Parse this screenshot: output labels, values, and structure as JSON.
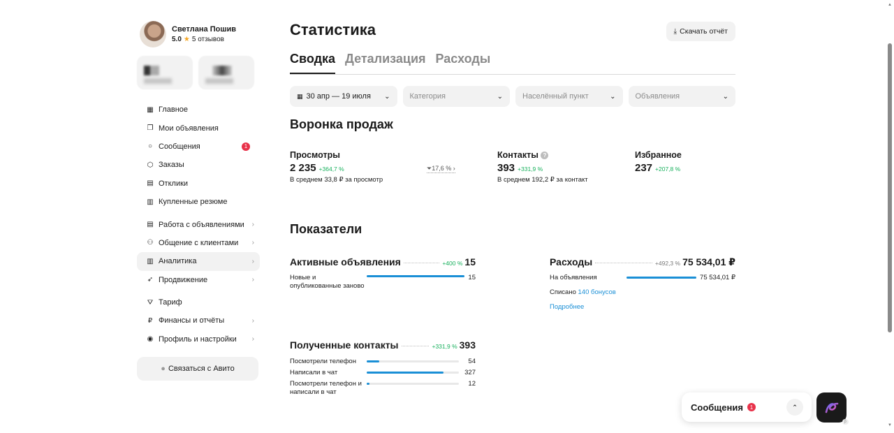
{
  "profile": {
    "name": "Светлана Пошив",
    "rating": "5.0",
    "reviews": "5 отзывов"
  },
  "sidebar": {
    "items": [
      {
        "icon": "grid-icon",
        "glyph": "▦",
        "label": "Главное"
      },
      {
        "icon": "copy-icon",
        "glyph": "❐",
        "label": "Мои объявления"
      },
      {
        "icon": "chat-icon",
        "glyph": "○",
        "label": "Сообщения",
        "badge": "1"
      },
      {
        "icon": "box-icon",
        "glyph": "⬡",
        "label": "Заказы"
      },
      {
        "icon": "doc-icon",
        "glyph": "▤",
        "label": "Отклики"
      },
      {
        "icon": "resume-icon",
        "glyph": "▥",
        "label": "Купленные резюме"
      }
    ],
    "items2": [
      {
        "icon": "list-icon",
        "glyph": "▤",
        "label": "Работа с объявлениями"
      },
      {
        "icon": "users-icon",
        "glyph": "⚇",
        "label": "Общение с клиентами"
      },
      {
        "icon": "analytics-icon",
        "glyph": "▥",
        "label": "Аналитика"
      },
      {
        "icon": "rocket-icon",
        "glyph": "➶",
        "label": "Продвижение"
      }
    ],
    "items3": [
      {
        "icon": "tariff-icon",
        "glyph": "⛛",
        "label": "Тариф"
      },
      {
        "icon": "ruble-icon",
        "glyph": "₽",
        "label": "Финансы и отчёты"
      },
      {
        "icon": "profile-icon",
        "glyph": "◉",
        "label": "Профиль и настройки"
      }
    ],
    "contact_label": "Связаться с Авито"
  },
  "header": {
    "title": "Статистика",
    "download_label": "Скачать отчёт"
  },
  "tabs": [
    "Сводка",
    "Детализация",
    "Расходы"
  ],
  "filters": {
    "date": "30 апр — 19 июля",
    "category": "Категория",
    "city": "Населённый пункт",
    "ads": "Объявления"
  },
  "funnel": {
    "title": "Воронка продаж",
    "views": {
      "label": "Просмотры",
      "value": "2 235",
      "change": "+364,7 %",
      "sub": "В среднем 33,8 ₽ за просмотр"
    },
    "conversion": "17,6 %",
    "contacts": {
      "label": "Контакты",
      "value": "393",
      "change": "+331,9 %",
      "sub": "В среднем 192,2 ₽ за контакт"
    },
    "favorites": {
      "label": "Избранное",
      "value": "237",
      "change": "+207,8 %"
    }
  },
  "metrics": {
    "title": "Показатели",
    "active": {
      "title": "Активные объявления",
      "change": "+400 %",
      "value": "15",
      "row_label": "Новые и опубликованные заново",
      "row_value": "15",
      "fill": 1.0
    },
    "expenses": {
      "title": "Расходы",
      "change": "+492,3 %",
      "value": "75 534,01 ₽",
      "row_label": "На объявления",
      "row_value": "75 534,01 ₽",
      "fill": 1.0,
      "written_off_prefix": "Списано",
      "written_off_link": "140 бонусов",
      "more_link": "Подробнее"
    },
    "contacts": {
      "title": "Полученные контакты",
      "change": "+331,9 %",
      "value": "393",
      "rows": [
        {
          "label": "Посмотрели телефон",
          "value": "54",
          "fill": 0.14
        },
        {
          "label": "Написали в чат",
          "value": "327",
          "fill": 0.83
        },
        {
          "label": "Посмотрели телефон и написали в чат",
          "value": "12",
          "fill": 0.03
        }
      ]
    }
  },
  "chat_widget": {
    "label": "Сообщения",
    "badge": "1"
  },
  "colors": {
    "accent": "#1a8fd6",
    "positive": "#17b05c",
    "badge": "#e8324a"
  }
}
